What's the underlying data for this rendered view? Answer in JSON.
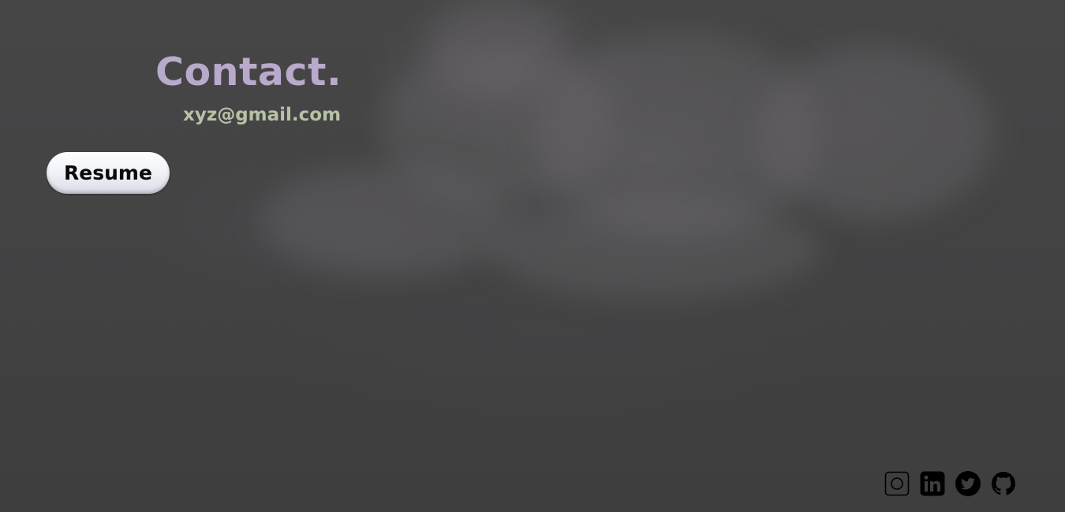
{
  "contact": {
    "title": "Contact.",
    "email": "xyz@gmail.com"
  },
  "resume": {
    "label": "Resume"
  },
  "socials": [
    {
      "name": "instagram",
      "icon": "instagram-icon"
    },
    {
      "name": "linkedin",
      "icon": "linkedin-icon"
    },
    {
      "name": "twitter",
      "icon": "twitter-icon"
    },
    {
      "name": "github",
      "icon": "github-icon"
    }
  ],
  "colors": {
    "background": "#3e3e3f",
    "title": "#b9aacb",
    "email": "#b7c2a5",
    "button_bg": "#eef0f6",
    "button_text": "#0a0a0a",
    "icon": "#000000"
  }
}
